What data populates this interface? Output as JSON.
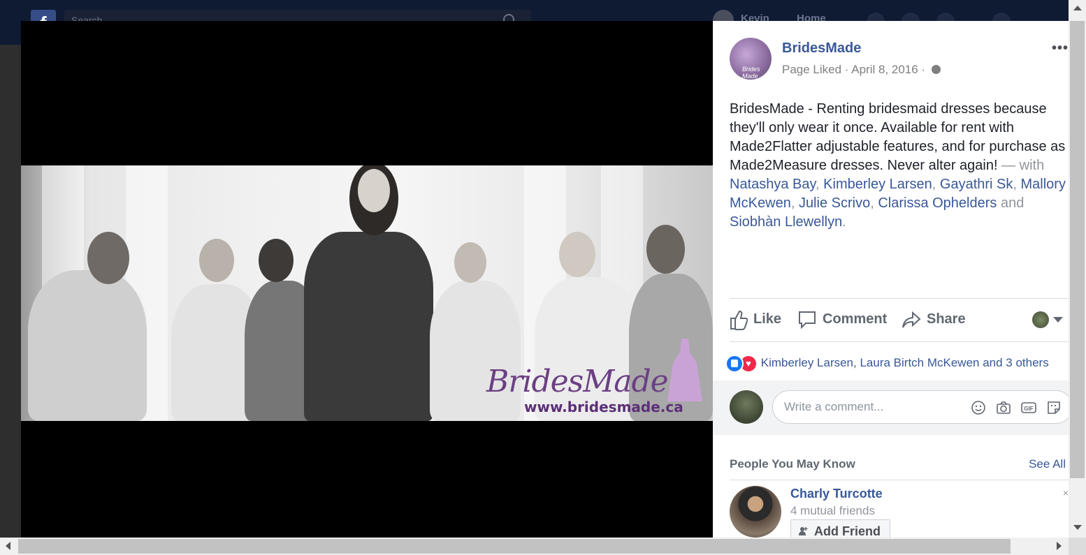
{
  "topbar": {
    "logo": "f",
    "search_placeholder": "Search",
    "user_name": "Kevin",
    "home_label": "Home"
  },
  "viewer": {
    "watermark_brand": "BridesMade",
    "watermark_url": "www.bridesmade.ca"
  },
  "post": {
    "page_name": "BridesMade",
    "avatar_text": "Brides Made",
    "status": "Page Liked",
    "date": "April 8, 2016",
    "body": "BridesMade - Renting bridesmaid dresses because they'll only wear it once. Available for rent with Made2Flatter adjustable features, and for purchase as Made2Measure dresses. Never alter again!",
    "with_prefix": "— with",
    "tagged": [
      "Natashya Bay",
      "Kimberley Larsen",
      "Gayathri Sk",
      "Mallory McKewen",
      "Julie Scrivo",
      "Clarissa Ophelders"
    ],
    "and_word": "and",
    "last_tagged": "Siobhàn Llewellyn",
    "more_icon": "•••"
  },
  "actions": {
    "like": "Like",
    "comment": "Comment",
    "share": "Share"
  },
  "reactions": {
    "text": "Kimberley Larsen, Laura Birtch McKewen and 3 others"
  },
  "comment_box": {
    "placeholder": "Write a comment..."
  },
  "pymk": {
    "title": "People You May Know",
    "see_all": "See All",
    "friend_name": "Charly Turcotte",
    "mutual": "4 mutual friends",
    "add_label": "Add Friend",
    "close": "×"
  }
}
